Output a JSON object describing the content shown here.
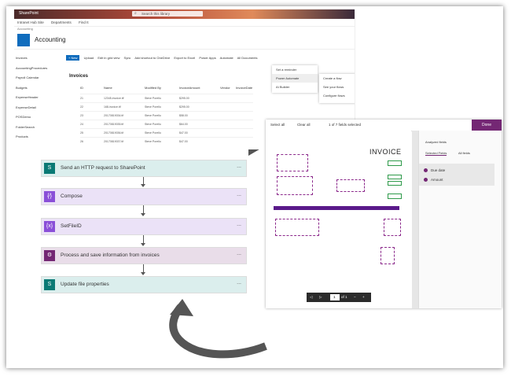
{
  "sharepoint": {
    "brand": "SharePoint",
    "search_placeholder": "Search this library",
    "nav_items": [
      "Intranet Hub Site",
      "Departments",
      "Find It"
    ],
    "sub_nav": "Accounting",
    "site_name": "Accounting",
    "sidebar": [
      "Invoices",
      "AccountingProcedures",
      "Payroll Calendar",
      "Budgets",
      "ExpenseHeader",
      "ExpenseDetail",
      "POSDemo",
      "FolderSearch",
      "Products"
    ],
    "command_bar": [
      "+ New",
      "Upload",
      "Edit in grid view",
      "Sync",
      "Add shortcut to OneDrive",
      "Export to Excel",
      "Power Apps",
      "Automate",
      "All Documents"
    ],
    "library_title": "Invoices",
    "columns": [
      "ID",
      "Name",
      "Modified By",
      "InvoiceAmount",
      "Vendor",
      "InvoiceDate"
    ],
    "rows": [
      {
        "id": "21",
        "name": "12345-invoice.tif",
        "modified_by": "Steve Porello",
        "amount": "$295.00"
      },
      {
        "id": "22",
        "name": "168-invoice.tif",
        "modified_by": "Steve Porello",
        "amount": "$295.00"
      },
      {
        "id": "23",
        "name": "20170819034.tif",
        "modified_by": "Steve Porello",
        "amount": "$58.00"
      },
      {
        "id": "24",
        "name": "20170819035.tif",
        "modified_by": "Steve Porello",
        "amount": "$64.00"
      },
      {
        "id": "25",
        "name": "20170819036.tif",
        "modified_by": "Steve Porello",
        "amount": "$47.00"
      },
      {
        "id": "26",
        "name": "20170819037.tif",
        "modified_by": "Steve Porello",
        "amount": "$47.00"
      }
    ],
    "automate_menu": [
      "Set a reminder",
      "Power Automate",
      "AI Builder"
    ],
    "automate_submenu": [
      "Create a flow",
      "See your flows",
      "Configure flows"
    ]
  },
  "flow_steps": [
    {
      "label": "Send an HTTP request to SharePoint",
      "icon": "sharepoint-icon",
      "color": "#0b7a75",
      "bg": "#dbeeed"
    },
    {
      "label": "Compose",
      "icon": "compose-icon",
      "color": "#8a4fd8",
      "bg": "#ebe2f7"
    },
    {
      "label": "SetFileID",
      "icon": "variable-icon",
      "color": "#8a4fd8",
      "bg": "#ebe2f7"
    },
    {
      "label": "Process and save information from invoices",
      "icon": "ai-builder-icon",
      "color": "#742774",
      "bg": "#e9dde9"
    },
    {
      "label": "Update file properties",
      "icon": "sharepoint-icon",
      "color": "#0b7a75",
      "bg": "#dbeeed"
    }
  ],
  "step_menu": "...",
  "invoice_viewer": {
    "select_all": "Select all",
    "clear_all": "Clear all",
    "selected_count": "1 of 7 fields selected",
    "done": "Done",
    "invoice_title": "INVOICE",
    "right_panel_heading": "Analyzed fields",
    "tabs": [
      "Selected Fields",
      "All fields"
    ],
    "fields": [
      "Due date",
      "Amount"
    ],
    "zoom_controls": [
      "◁",
      "▷",
      "1",
      "of 1",
      "−",
      "+"
    ]
  },
  "colors": {
    "purple": "#742774",
    "blue": "#0f6cbd",
    "teal": "#0b7a75",
    "arrow": "#555555"
  }
}
